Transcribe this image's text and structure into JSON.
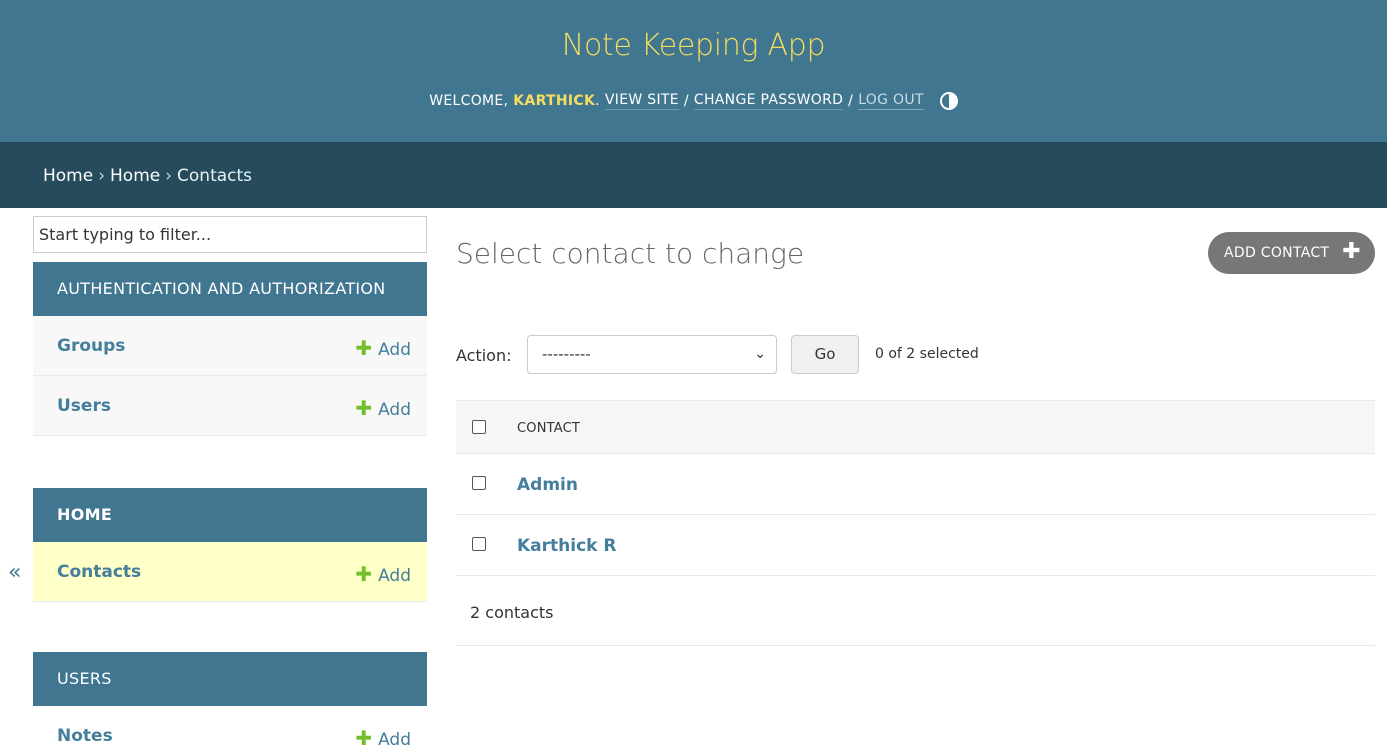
{
  "header": {
    "site_title": "Note Keeping App",
    "welcome": "WELCOME,",
    "username": "KARTHICK",
    "view_site": "VIEW SITE",
    "change_password": "CHANGE PASSWORD",
    "log_out": "LOG OUT",
    "separator": "/"
  },
  "breadcrumbs": {
    "items": [
      "Home",
      "Home",
      "Contacts"
    ],
    "separator": "›"
  },
  "sidebar": {
    "toggle_label": "«",
    "filter_placeholder": "Start typing to filter...",
    "modules": [
      {
        "caption": "AUTHENTICATION AND AUTHORIZATION",
        "models": [
          {
            "name": "Groups",
            "add": "Add"
          },
          {
            "name": "Users",
            "add": "Add"
          }
        ]
      },
      {
        "caption": "HOME",
        "models": [
          {
            "name": "Contacts",
            "add": "Add"
          }
        ]
      },
      {
        "caption": "USERS",
        "models": [
          {
            "name": "Notes",
            "add": "Add"
          }
        ]
      }
    ]
  },
  "main": {
    "title": "Select contact to change",
    "add_button": "ADD CONTACT",
    "action_label": "Action:",
    "action_selected": "---------",
    "go_label": "Go",
    "selected_count": "0 of 2 selected",
    "column_header": "CONTACT",
    "rows": [
      "Admin",
      "Karthick R"
    ],
    "paginator": "2 contacts"
  },
  "colors": {
    "header_bg": "#417690",
    "breadcrumb_bg": "#264b5d",
    "title_yellow": "#f5dd5d",
    "link_blue": "#447e9b",
    "selected_row": "#ffffc8",
    "add_green": "#70bf2b"
  }
}
